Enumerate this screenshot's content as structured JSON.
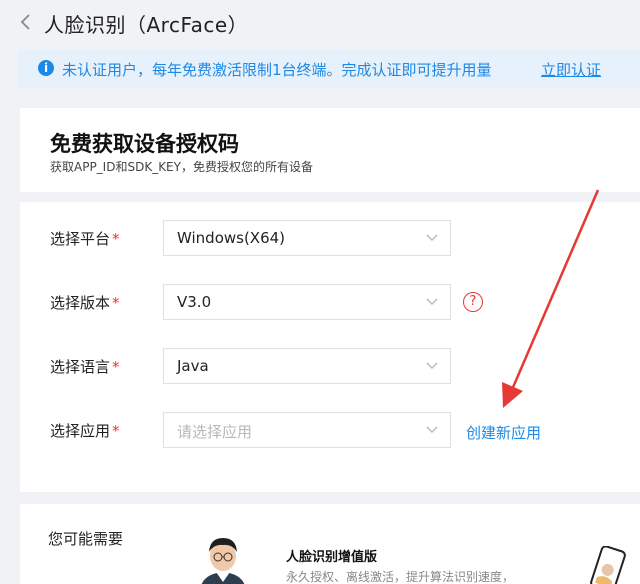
{
  "header": {
    "title": "人脸识别（ArcFace）"
  },
  "notice": {
    "text": "未认证用户，每年免费激活限制1台终端。完成认证即可提升用量",
    "link": "立即认证",
    "info_glyph": "i",
    "color": "#1e88e5",
    "background": "#e6f1fb"
  },
  "authorize": {
    "title": "免费获取设备授权码",
    "subtitle": "获取APP_ID和SDK_KEY，免费授权您的所有设备"
  },
  "form": {
    "required_mark": "*",
    "platform": {
      "label": "选择平台",
      "value": "Windows(X64)"
    },
    "version": {
      "label": "选择版本",
      "value": "V3.0",
      "help_glyph": "?"
    },
    "language": {
      "label": "选择语言",
      "value": "Java"
    },
    "app": {
      "label": "选择应用",
      "placeholder": "请选择应用",
      "create_link": "创建新应用"
    }
  },
  "recommend": {
    "title": "您可能需要",
    "product": {
      "name": "人脸识别增值版",
      "desc": "永久授权、离线激活，提升算法识别速度，"
    }
  },
  "colors": {
    "accent": "#1e88e5",
    "required": "#e53935",
    "annotation_arrow": "#e53935"
  }
}
